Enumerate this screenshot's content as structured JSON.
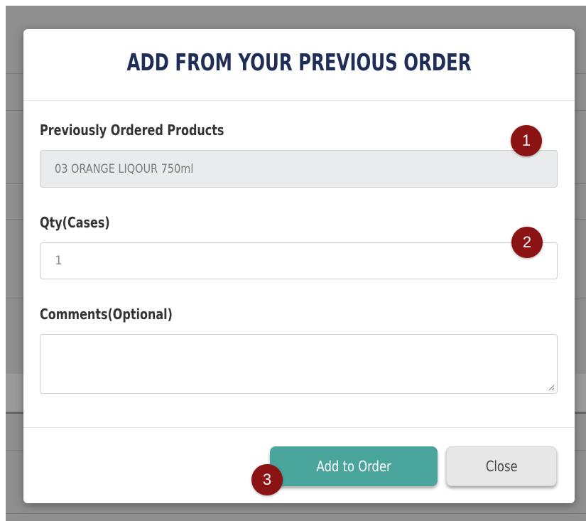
{
  "modal": {
    "title": "ADD FROM YOUR PREVIOUS ORDER",
    "fields": {
      "previous_products": {
        "label": "Previously Ordered Products",
        "value": "03 ORANGE LIQOUR 750ml"
      },
      "qty": {
        "label": "Qty(Cases)",
        "value": "1"
      },
      "comments": {
        "label": "Comments(Optional)",
        "value": ""
      }
    },
    "buttons": {
      "add": "Add to Order",
      "close": "Close"
    }
  },
  "callouts": [
    "1",
    "2",
    "3"
  ],
  "colors": {
    "title": "#1f2d57",
    "primary_button": "#4aa59c",
    "callout": "#8c1313",
    "backdrop": "#8f8f8f"
  },
  "icons": {
    "resize": "resize-grip-icon"
  }
}
